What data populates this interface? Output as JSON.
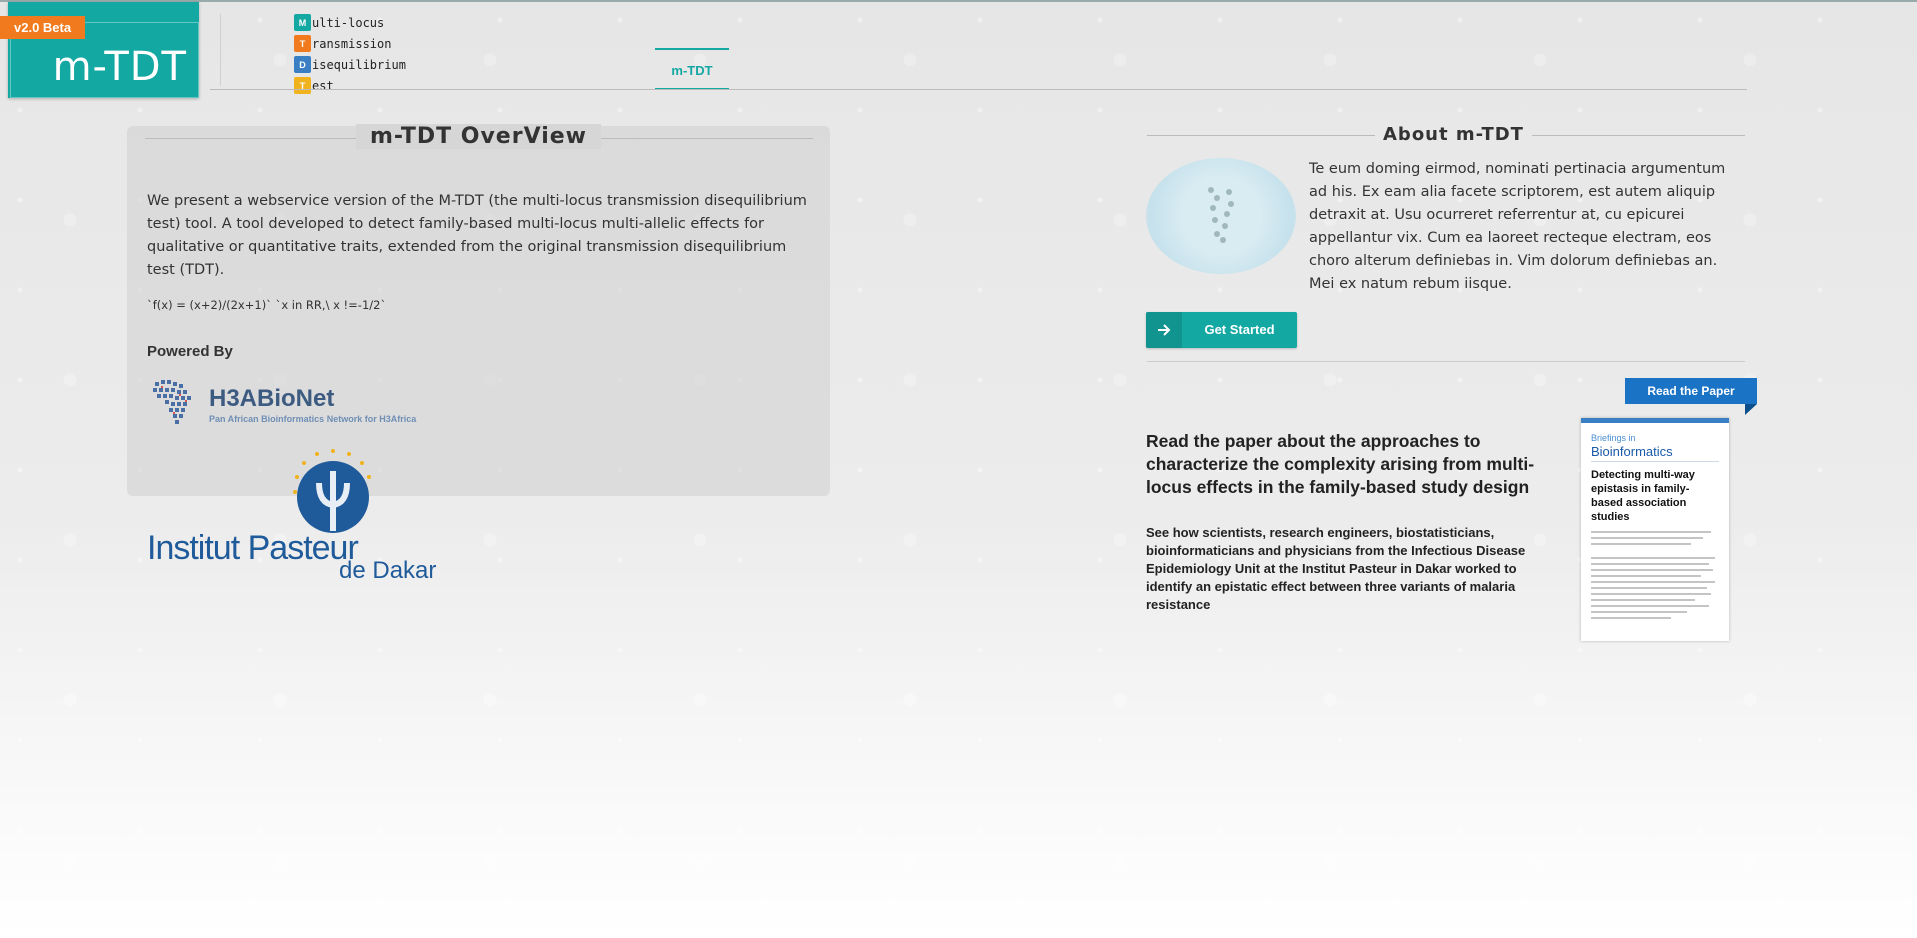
{
  "header": {
    "badge": "v2.0 Beta",
    "logo_text": "m-TDT",
    "acronym": [
      {
        "letter": "M",
        "rest": "ulti-locus",
        "color": "#14a8a3"
      },
      {
        "letter": "T",
        "rest": "ransmission",
        "color": "#f07a1d"
      },
      {
        "letter": "D",
        "rest": "isequilibrium",
        "color": "#3a7fc4"
      },
      {
        "letter": "T",
        "rest": "est",
        "color": "#f0b21d"
      }
    ],
    "nav": {
      "active_tab": "m-TDT"
    }
  },
  "overview": {
    "title": "m-TDT OverView",
    "paragraph": "We present a webservice version of the M-TDT (the multi-locus transmission disequilibrium test) tool. A tool developed to detect family-based multi-locus multi-allelic effects for qualitative or quantitative traits, extended from the original transmission disequilibrium test (TDT).",
    "formula": "`f(x) = (x+2)/(2x+1)` `x in RR,\\ x !=-1/2`",
    "powered_by": "Powered By",
    "sponsors": {
      "h3abionet": {
        "name": "H3ABioNet",
        "subtitle": "Pan African Bioinformatics Network for H3Africa"
      },
      "pasteur": {
        "name": "Institut Pasteur",
        "subtitle": "de Dakar"
      }
    }
  },
  "about": {
    "title": "About m-TDT",
    "text": "Te eum doming eirmod, nominati pertinacia argumentum ad his. Ex eam alia facete scriptorem, est autem aliquip detraxit at. Usu ocurreret referrentur at, cu epicurei appellantur vix. Cum ea laoreet recteque electram, eos choro alterum definiebas in. Vim dolorum definiebas an. Mei ex natum rebum iisque.",
    "button": "Get Started"
  },
  "paper": {
    "ribbon": "Read the Paper",
    "headline": "Read the paper about the approaches to characterize the complexity arising from multi-locus effects in the family-based study design",
    "body": "See how scientists, research engineers, biostatisticians, bioinformaticians and physicians from the Infectious Disease Epidemiology Unit at the Institut Pasteur in Dakar worked to identify an epistatic effect between three variants of malaria resistance",
    "journal": {
      "series": "Briefings in",
      "name": "Bioinformatics",
      "article_title": "Detecting multi-way epistasis in family-based association studies"
    }
  },
  "colors": {
    "teal": "#14a8a3",
    "orange": "#f07a1d",
    "blue": "#1a73c4"
  }
}
